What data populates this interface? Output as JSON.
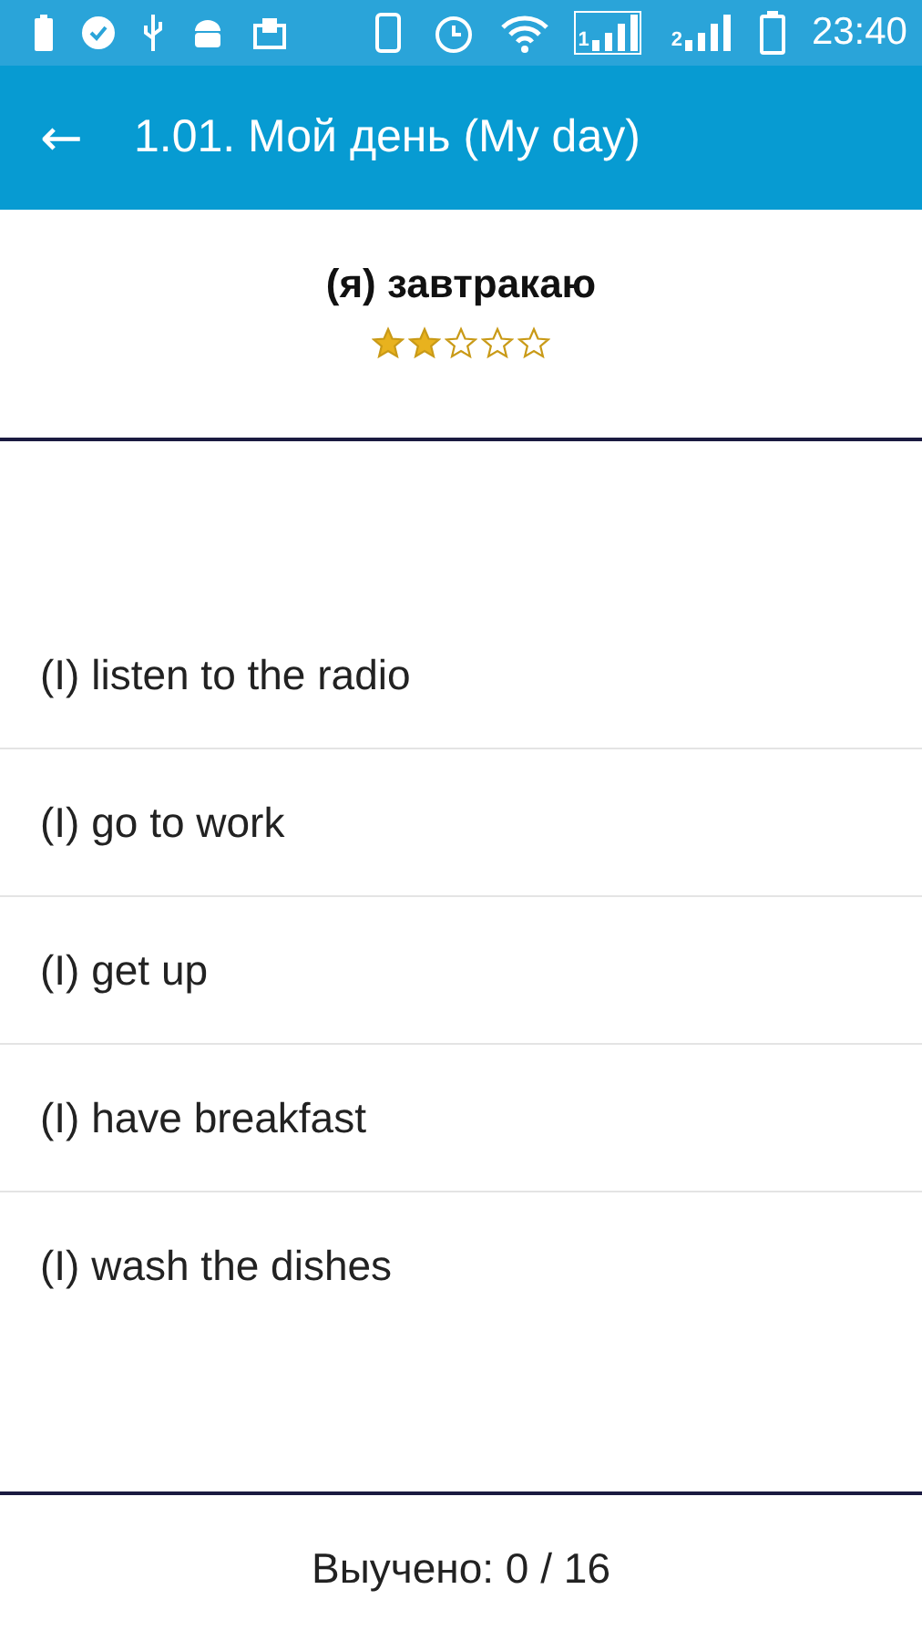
{
  "status_bar": {
    "time": "23:40",
    "sim_labels": [
      "1",
      "2"
    ]
  },
  "toolbar": {
    "back_icon": "←",
    "title": "1.01. Мой день (My day)"
  },
  "word": {
    "text": "(я) завтракаю",
    "stars": 2
  },
  "options": [
    {
      "text": "(I) listen to the radio"
    },
    {
      "text": "(I) go to work"
    },
    {
      "text": "(I) get up"
    },
    {
      "text": "(I) have breakfast"
    },
    {
      "text": "(I) wash the dishes"
    }
  ],
  "footer": {
    "progress": "Выучено: 0 / 16"
  }
}
